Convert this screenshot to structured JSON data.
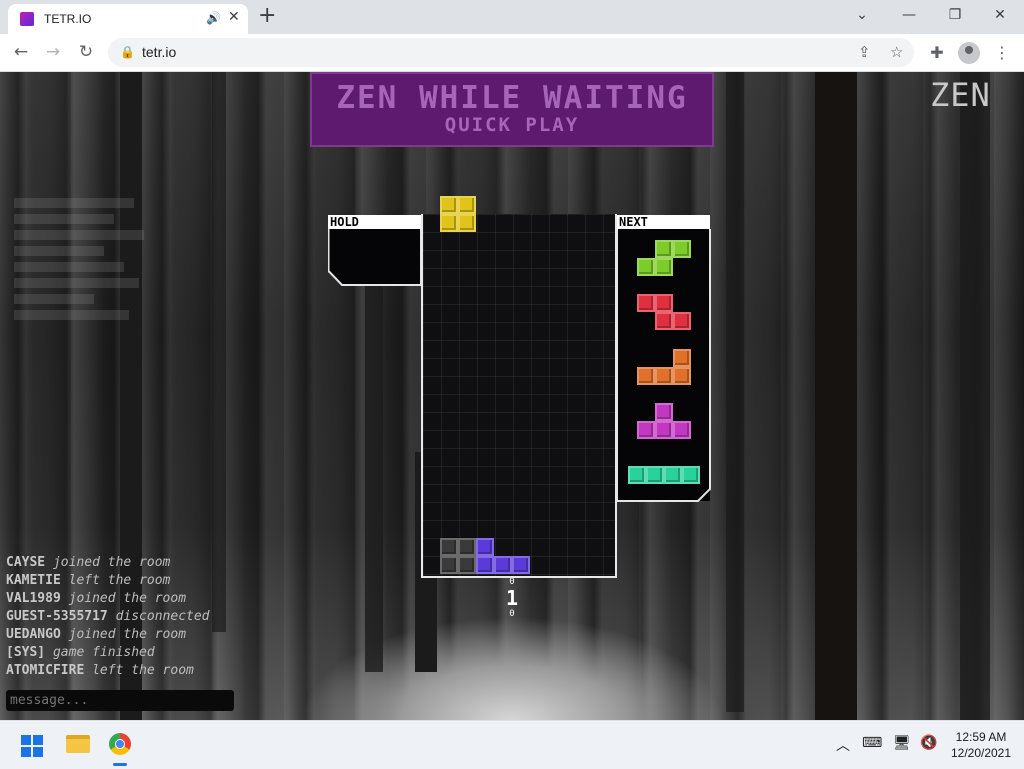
{
  "browser": {
    "tab_title": "TETR.IO",
    "url": "tetr.io",
    "window_controls": [
      "chevron-down-icon",
      "minimize-icon",
      "restore-icon",
      "close-icon"
    ]
  },
  "game": {
    "banner_title": "ZEN WHILE WAITING",
    "banner_subtitle": "QUICK PLAY",
    "mode": "ZEN",
    "hold_label": "HOLD",
    "next_label": "NEXT",
    "counter_top": "0",
    "counter_value": "1",
    "counter_bottom": "0",
    "colors": {
      "O": "#e0c41a",
      "S": "#7ccc2a",
      "Z": "#e03040",
      "L": "#e0702a",
      "T": "#c238c2",
      "I": "#2ad19a",
      "J": "#5a3ad8",
      "garbage": "#3a3a3a"
    },
    "active_piece": "O",
    "next_queue": [
      "S",
      "Z",
      "L",
      "T",
      "I"
    ],
    "board_cells": [
      {
        "piece": "garbage",
        "row": 18,
        "col": 1
      },
      {
        "piece": "garbage",
        "row": 18,
        "col": 2
      },
      {
        "piece": "garbage",
        "row": 19,
        "col": 1
      },
      {
        "piece": "garbage",
        "row": 19,
        "col": 2
      },
      {
        "piece": "J",
        "row": 18,
        "col": 3
      },
      {
        "piece": "J",
        "row": 19,
        "col": 3
      },
      {
        "piece": "J",
        "row": 19,
        "col": 4
      },
      {
        "piece": "J",
        "row": 19,
        "col": 5
      }
    ]
  },
  "chat": {
    "messages": [
      {
        "name": "CAYSE",
        "text": "joined the room"
      },
      {
        "name": "KAMETIE",
        "text": "left the room"
      },
      {
        "name": "VAL1989",
        "text": "joined the room"
      },
      {
        "name": "GUEST-5355717",
        "text": "disconnected"
      },
      {
        "name": "UEDANGO",
        "text": "joined the room"
      },
      {
        "name": "[SYS]",
        "text": "game finished"
      },
      {
        "name": "ATOMICFIRE",
        "text": "left the room"
      }
    ],
    "placeholder": "message..."
  },
  "taskbar": {
    "time": "12:59 AM",
    "date": "12/20/2021"
  }
}
